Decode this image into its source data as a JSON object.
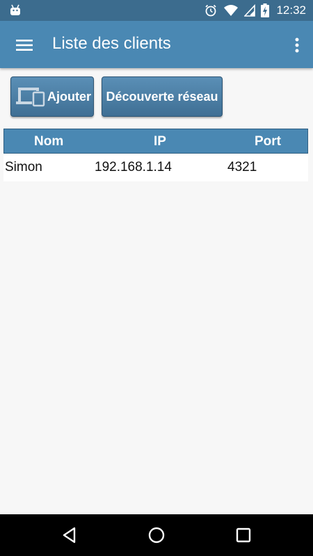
{
  "status_bar": {
    "time": "12:32",
    "icons": [
      "android-icon",
      "alarm-icon",
      "wifi-icon",
      "signal-icon",
      "battery-charging-icon"
    ]
  },
  "toolbar": {
    "title": "Liste des clients",
    "menu_icon": "hamburger-menu-icon",
    "overflow_icon": "more-vert-icon"
  },
  "actions": {
    "add_label": "Ajouter",
    "add_icon": "devices-icon",
    "discover_label": "Découverte réseau"
  },
  "table": {
    "headers": [
      "Nom",
      "IP",
      "Port"
    ],
    "rows": [
      [
        "Simon",
        "192.168.1.14",
        "4321"
      ]
    ]
  },
  "nav_bar": {
    "icons": [
      "back-icon",
      "home-icon",
      "recents-icon"
    ]
  },
  "colors": {
    "status_bar": "#3c6c8e",
    "toolbar": "#4a88b3",
    "button": "#4a7ca3",
    "background": "#f7f7f7"
  }
}
